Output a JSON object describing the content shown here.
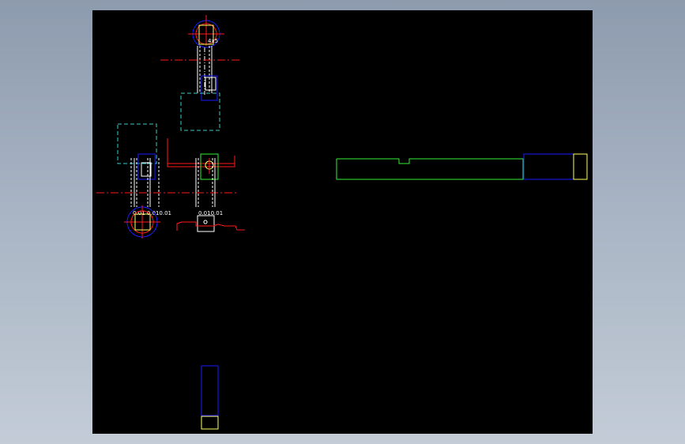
{
  "viewer": {
    "background": "#000000",
    "frame_gradient": [
      "#8d9bae",
      "#c3ccd7"
    ]
  },
  "layer_colors": {
    "blue": "#1a1aff",
    "red": "#ff1a1a",
    "white": "#ffffff",
    "yellow": "#ffff66",
    "green": "#33ee33",
    "cyan": "#33cccc"
  }
}
